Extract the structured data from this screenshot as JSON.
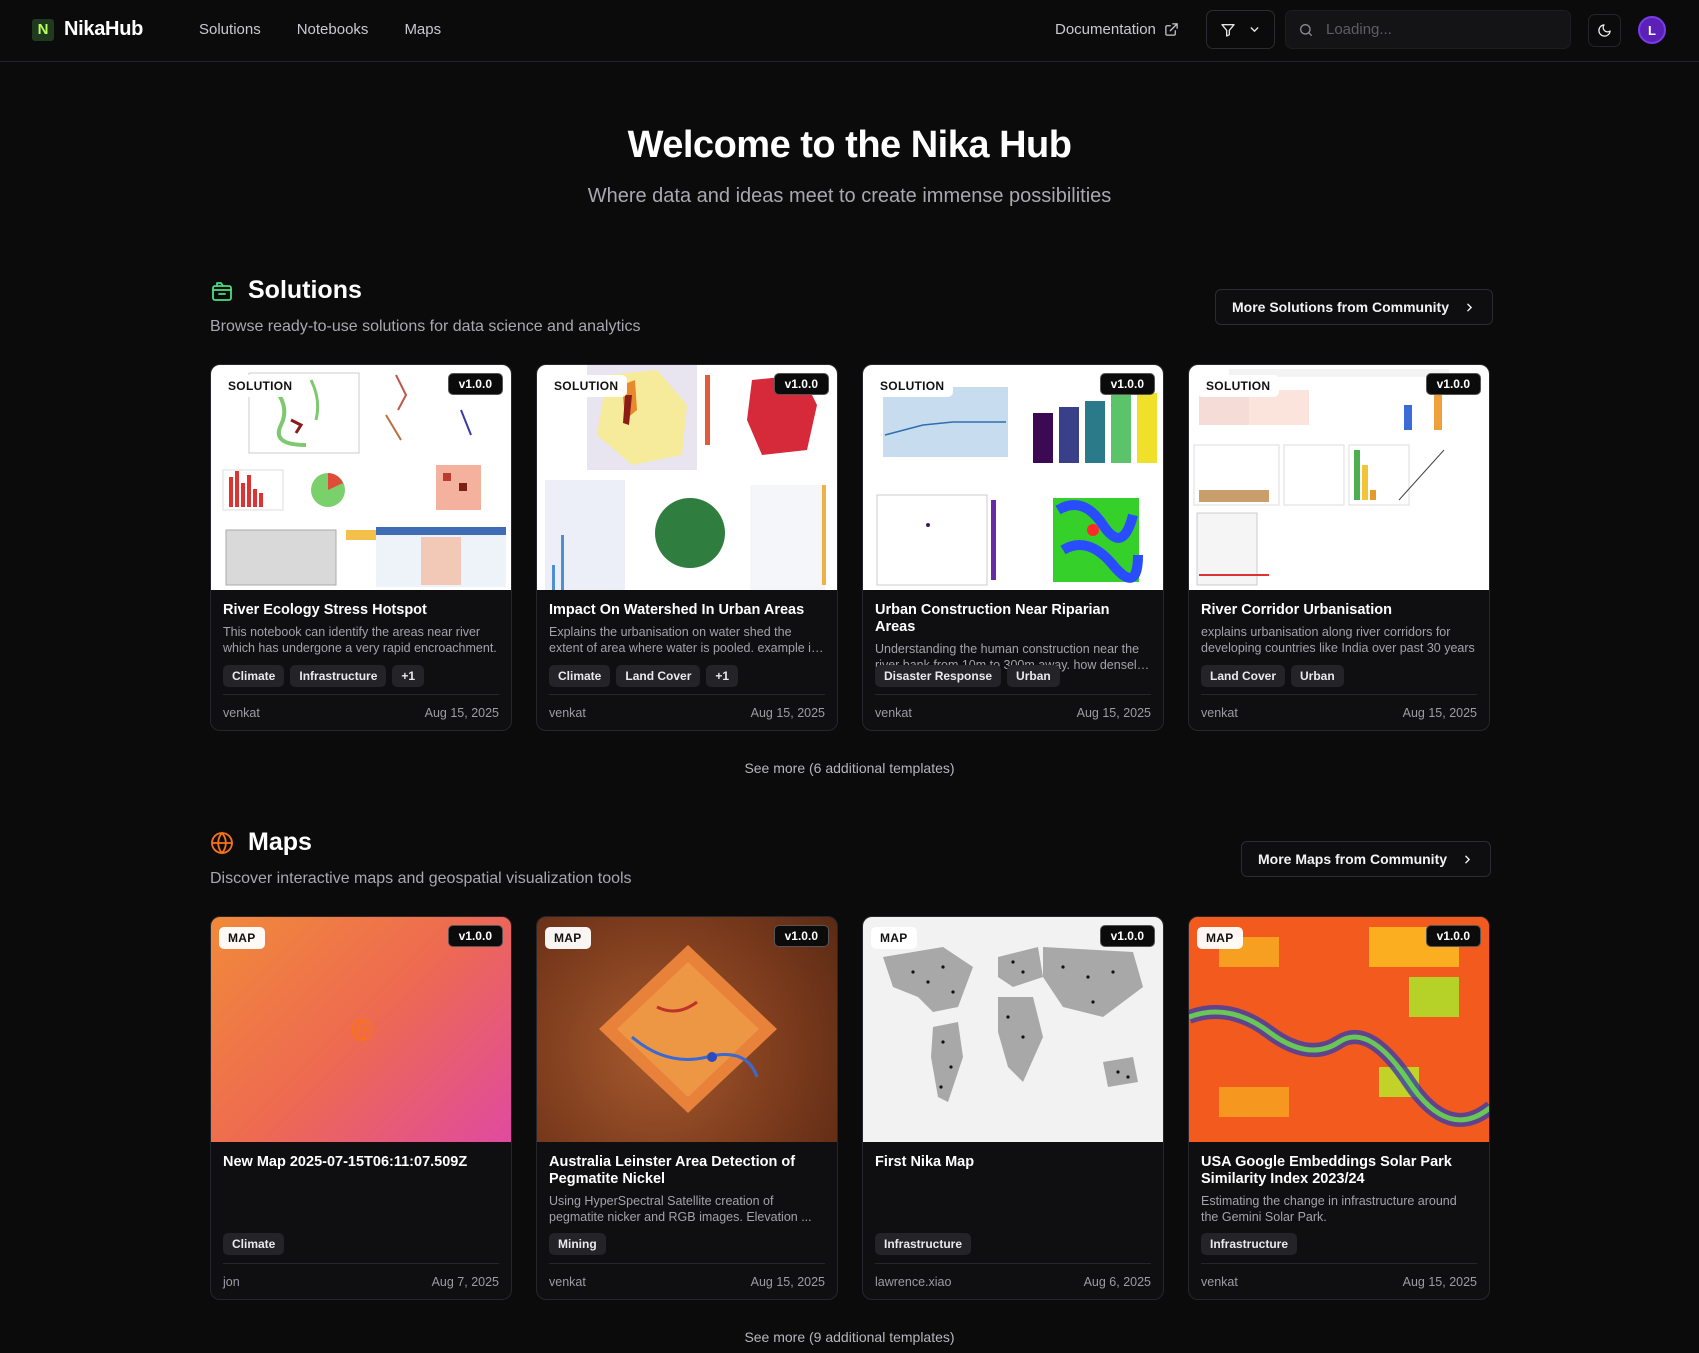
{
  "header": {
    "brand_letter": "N",
    "brand_name": "NikaHub",
    "nav": [
      "Solutions",
      "Notebooks",
      "Maps"
    ],
    "documentation": "Documentation",
    "search_placeholder": "Loading...",
    "avatar_initial": "L"
  },
  "hero": {
    "title": "Welcome to the Nika Hub",
    "subtitle": "Where data and ideas meet to create immense possibilities"
  },
  "solutions": {
    "title": "Solutions",
    "description": "Browse ready-to-use solutions for data science and analytics",
    "more_button": "More Solutions from Community",
    "see_more": "See more (6 additional templates)",
    "cards": [
      {
        "type": "SOLUTION",
        "version": "v1.0.0",
        "title": "River Ecology Stress Hotspot",
        "description": "This notebook can identify the areas near river which has undergone a very rapid encroachment.",
        "tags": [
          "Climate",
          "Infrastructure",
          "+1"
        ],
        "author": "venkat",
        "date": "Aug 15, 2025"
      },
      {
        "type": "SOLUTION",
        "version": "v1.0.0",
        "title": "Impact On Watershed In Urban Areas",
        "description": "Explains the urbanisation on water shed the extent of area where water is pooled. example is ...",
        "tags": [
          "Climate",
          "Land Cover",
          "+1"
        ],
        "author": "venkat",
        "date": "Aug 15, 2025"
      },
      {
        "type": "SOLUTION",
        "version": "v1.0.0",
        "title": "Urban Construction Near Riparian Areas",
        "description": "Understanding the human construction near the river bank from 10m to 300m away. how densely ...",
        "tags": [
          "Disaster Response",
          "Urban"
        ],
        "author": "venkat",
        "date": "Aug 15, 2025"
      },
      {
        "type": "SOLUTION",
        "version": "v1.0.0",
        "title": "River Corridor Urbanisation",
        "description": "explains urbanisation along river corridors for developing countries like India over past 30 years",
        "tags": [
          "Land Cover",
          "Urban"
        ],
        "author": "venkat",
        "date": "Aug 15, 2025"
      }
    ]
  },
  "maps": {
    "title": "Maps",
    "description": "Discover interactive maps and geospatial visualization tools",
    "more_button": "More Maps from Community",
    "see_more": "See more (9 additional templates)",
    "cards": [
      {
        "type": "MAP",
        "version": "v1.0.0",
        "title": "New Map 2025-07-15T06:11:07.509Z",
        "description": "",
        "tags": [
          "Climate"
        ],
        "author": "jon",
        "date": "Aug 7, 2025"
      },
      {
        "type": "MAP",
        "version": "v1.0.0",
        "title": "Australia Leinster Area Detection of Pegmatite Nickel",
        "description": "Using HyperSpectral Satellite creation of pegmatite nicker and RGB images. Elevation ...",
        "tags": [
          "Mining"
        ],
        "author": "venkat",
        "date": "Aug 15, 2025"
      },
      {
        "type": "MAP",
        "version": "v1.0.0",
        "title": "First Nika Map",
        "description": "",
        "tags": [
          "Infrastructure"
        ],
        "author": "lawrence.xiao",
        "date": "Aug 6, 2025"
      },
      {
        "type": "MAP",
        "version": "v1.0.0",
        "title": "USA Google Embeddings Solar Park Similarity Index 2023/24",
        "description": "Estimating the change in infrastructure around the Gemini Solar Park.",
        "tags": [
          "Infrastructure"
        ],
        "author": "venkat",
        "date": "Aug 15, 2025"
      }
    ]
  },
  "colors": {
    "accent_green": "#b8ff5a",
    "solutions_icon": "#4ade80",
    "maps_icon": "#f97316"
  }
}
